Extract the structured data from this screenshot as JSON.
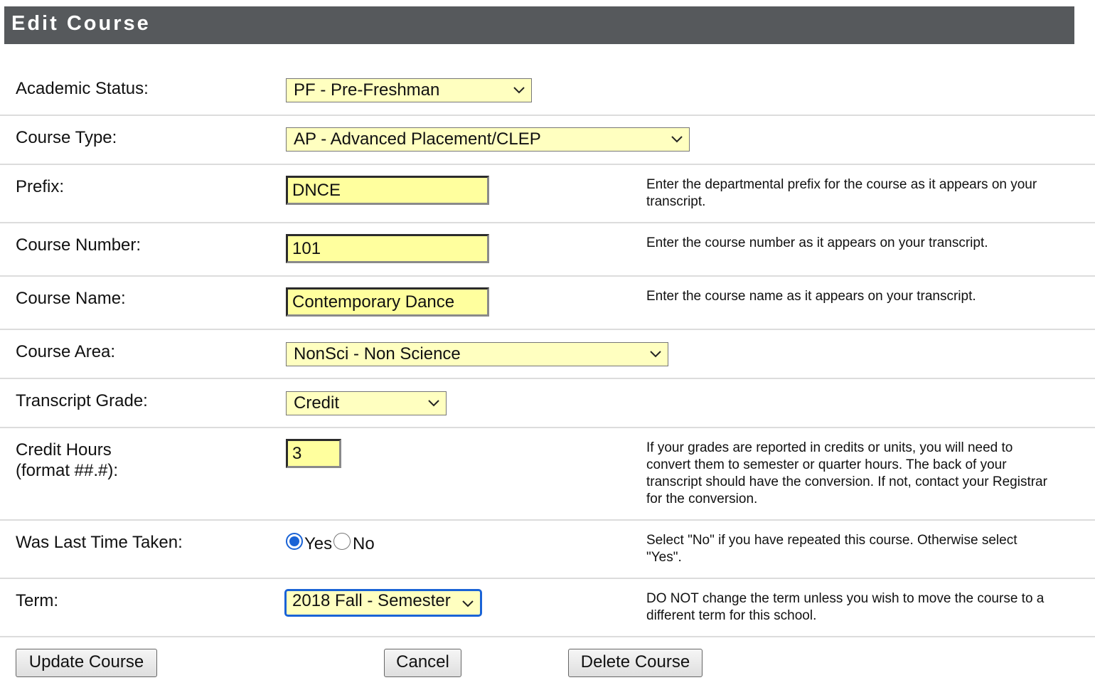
{
  "header": {
    "title": "Edit Course"
  },
  "fields": {
    "academic_status": {
      "label": "Academic Status:",
      "value": "PF - Pre-Freshman"
    },
    "course_type": {
      "label": "Course Type:",
      "value": "AP - Advanced Placement/CLEP"
    },
    "prefix": {
      "label": "Prefix:",
      "value": "DNCE",
      "help": "Enter the departmental prefix for the course as it appears on your transcript."
    },
    "course_number": {
      "label": "Course Number:",
      "value": "101",
      "help": "Enter the course number as it appears on your transcript."
    },
    "course_name": {
      "label": "Course Name:",
      "value": "Contemporary Dance",
      "help": "Enter the course name as it appears on your transcript."
    },
    "course_area": {
      "label": "Course Area:",
      "value": "NonSci - Non Science"
    },
    "transcript_grade": {
      "label": "Transcript Grade:",
      "value": "Credit"
    },
    "credit_hours": {
      "label_line1": "Credit Hours",
      "label_line2": "(format ##.#):",
      "value": "3",
      "help": "If your grades are reported in credits or units, you will need to convert them to semester or quarter hours.  The back of your transcript should have the conversion.  If not, contact your Registrar for the conversion."
    },
    "last_time_taken": {
      "label": "Was Last Time Taken:",
      "yes_label": "Yes",
      "no_label": "No",
      "selected": "Yes",
      "help": "Select \"No\" if you have repeated this course. Otherwise select \"Yes\"."
    },
    "term": {
      "label": "Term:",
      "value": "2018 Fall - Semester",
      "help": "DO NOT change the term unless you wish to move the course to a different term for this school."
    }
  },
  "buttons": {
    "update": "Update Course",
    "cancel": "Cancel",
    "delete": "Delete Course"
  },
  "colors": {
    "header_bg": "#56595c",
    "field_bg": "#ffffc0",
    "focus": "#1a63d6"
  }
}
